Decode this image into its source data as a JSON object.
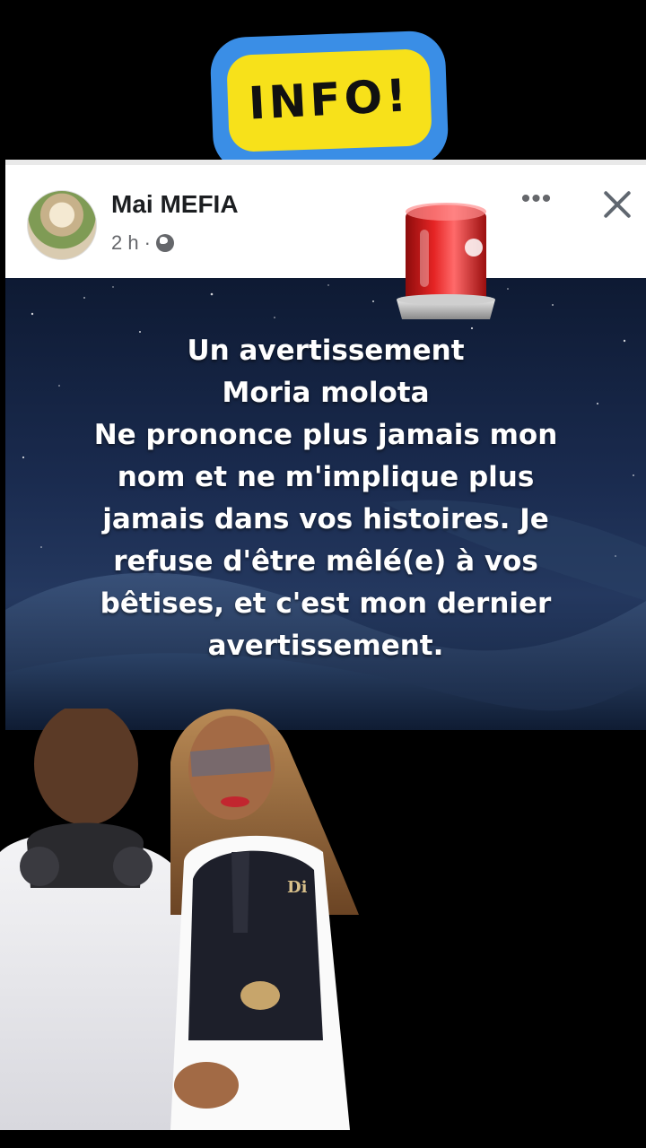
{
  "sticker": {
    "label": "INFO!"
  },
  "post": {
    "author_name": "Mai MEFIA",
    "time": "2 h",
    "separator": "·",
    "more_label": "•••",
    "body_lines": [
      "Un avertissement",
      "Moria molota",
      "Ne prononce plus jamais mon",
      "nom et ne m'implique plus",
      "jamais dans vos histoires. Je",
      "refuse d'être mêlé(e) à vos",
      "bêtises, et c'est mon dernier",
      "avertissement."
    ]
  },
  "icons": {
    "globe": "globe-icon",
    "close": "close-icon",
    "more": "more-icon",
    "siren": "police-siren-icon"
  },
  "photo": {
    "badge": "Di"
  },
  "colors": {
    "sticker_blue": "#3a8ee6",
    "sticker_yellow": "#f7e11a",
    "siren_red": "#d41a1a",
    "background": "#000000"
  }
}
